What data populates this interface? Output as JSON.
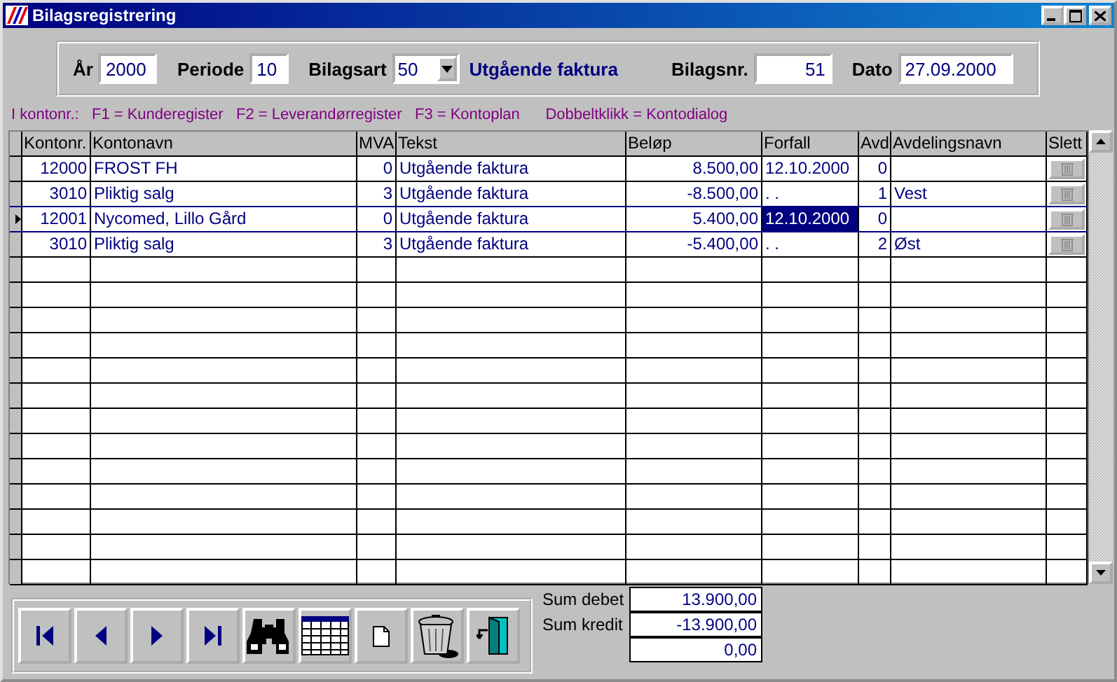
{
  "window": {
    "title": "Bilagsregistrering"
  },
  "header": {
    "year_label": "År",
    "year": "2000",
    "period_label": "Periode",
    "period": "10",
    "type_label": "Bilagsart",
    "type": "50",
    "type_name": "Utgående faktura",
    "number_label": "Bilagsnr.",
    "number": "51",
    "date_label": "Dato",
    "date": "27.09.2000"
  },
  "hint": "I kontonr.:   F1 = Kunderegister   F2 = Leverandørregister   F3 = Kontoplan      Dobbeltklikk = Kontodialog",
  "table": {
    "columns": [
      "Kontonr.",
      "Kontonavn",
      "MVA",
      "Tekst",
      "Beløp",
      "Forfall",
      "Avd",
      "Avdelingsnavn",
      "Slett"
    ],
    "rows": [
      {
        "kontonr": "12000",
        "kontonavn": "FROST FH",
        "mva": "0",
        "tekst": "Utgående faktura",
        "belop": "8.500,00",
        "forfall": "12.10.2000",
        "avd": "0",
        "avdelingsnavn": "",
        "selected": false
      },
      {
        "kontonr": "3010",
        "kontonavn": "Pliktig salg",
        "mva": "3",
        "tekst": "Utgående faktura",
        "belop": "-8.500,00",
        "forfall": ". .",
        "avd": "1",
        "avdelingsnavn": "Vest",
        "selected": false
      },
      {
        "kontonr": "12001",
        "kontonavn": "Nycomed, Lillo Gård",
        "mva": "0",
        "tekst": "Utgående faktura",
        "belop": "5.400,00",
        "forfall": "12.10.2000",
        "avd": "0",
        "avdelingsnavn": "",
        "selected": true
      },
      {
        "kontonr": "3010",
        "kontonavn": "Pliktig salg",
        "mva": "3",
        "tekst": "Utgående faktura",
        "belop": "-5.400,00",
        "forfall": ". .",
        "avd": "2",
        "avdelingsnavn": "Øst",
        "selected": false
      }
    ]
  },
  "sums": [
    {
      "label": "Sum debet",
      "value": "13.900,00"
    },
    {
      "label": "Sum kredit",
      "value": "-13.900,00"
    },
    {
      "value": "0,00"
    }
  ]
}
